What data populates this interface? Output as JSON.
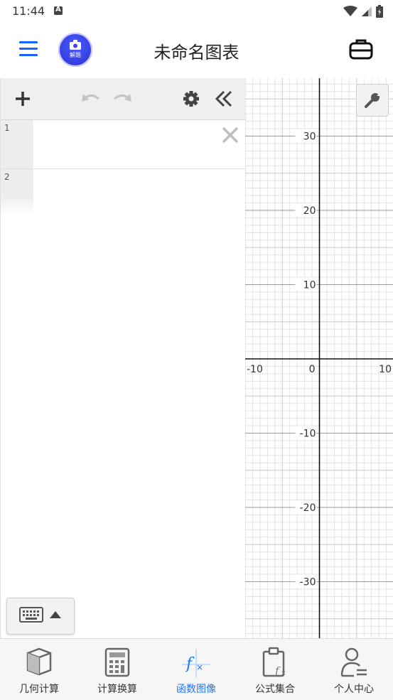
{
  "status_bar": {
    "time": "11:44",
    "notification_letter": "A"
  },
  "app_bar": {
    "title": "未命名图表",
    "camera_label": "解题"
  },
  "expressions": [
    {
      "index": "1",
      "value": ""
    },
    {
      "index": "2",
      "value": ""
    }
  ],
  "graph": {
    "x_tick_labels": [
      "-10",
      "0",
      "10"
    ],
    "y_tick_labels": [
      "30",
      "20",
      "10",
      "-10",
      "-20",
      "-30"
    ]
  },
  "bottom_nav": {
    "items": [
      {
        "label": "几何计算",
        "icon": "cube-icon"
      },
      {
        "label": "计算换算",
        "icon": "calculator-icon"
      },
      {
        "label": "函数图像",
        "icon": "function-graph-icon"
      },
      {
        "label": "公式集合",
        "icon": "formula-clipboard-icon"
      },
      {
        "label": "个人中心",
        "icon": "user-icon"
      }
    ],
    "active_index": 2
  },
  "colors": {
    "accent": "#1976ff",
    "menu_blue": "#1565ff",
    "camera_blue": "#2a2fd0"
  }
}
